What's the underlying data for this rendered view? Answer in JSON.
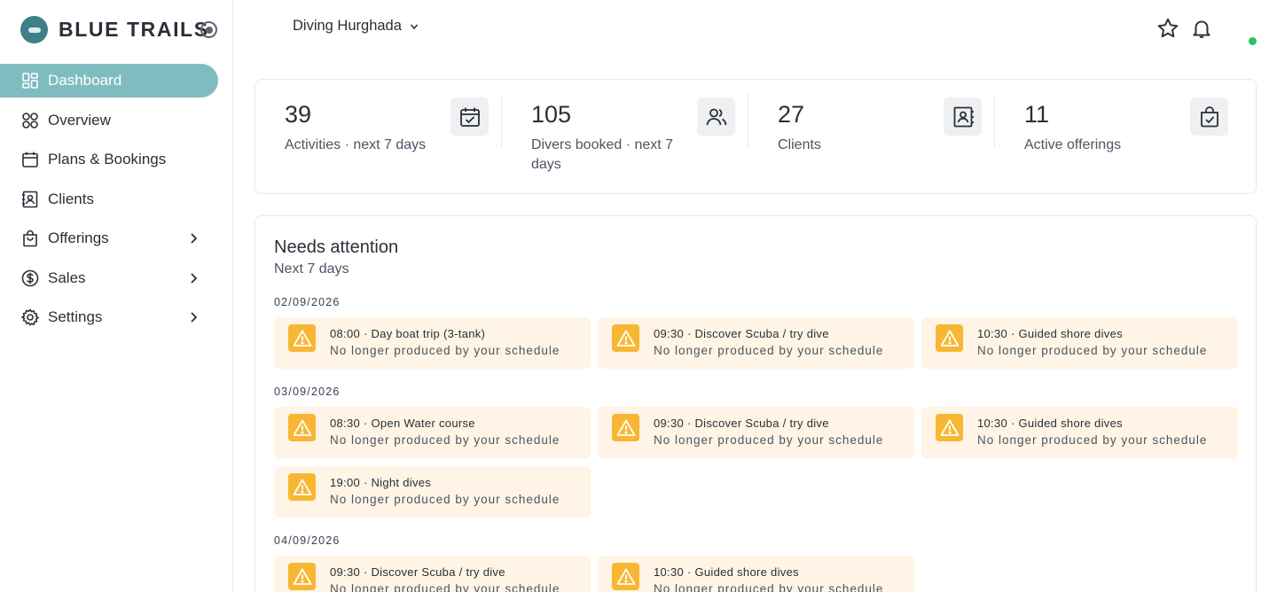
{
  "brand": {
    "name": "BLUE TRAILS"
  },
  "sidebar": {
    "items": [
      {
        "label": "Dashboard",
        "icon": "dashboard-icon",
        "active": true
      },
      {
        "label": "Overview",
        "icon": "overview-icon"
      },
      {
        "label": "Plans & Bookings",
        "icon": "calendar-icon"
      },
      {
        "label": "Clients",
        "icon": "contacts-icon"
      },
      {
        "label": "Offerings",
        "icon": "bag-icon",
        "expandable": true
      },
      {
        "label": "Sales",
        "icon": "dollar-icon",
        "expandable": true
      },
      {
        "label": "Settings",
        "icon": "gear-icon",
        "expandable": true
      }
    ]
  },
  "header": {
    "location": "Diving Hurghada",
    "icons": [
      "star-icon",
      "bell-icon"
    ],
    "status_color": "#22c55e"
  },
  "stats": [
    {
      "value": "39",
      "label": "Activities · next 7 days",
      "icon": "calendar-check-icon"
    },
    {
      "value": "105",
      "label": "Divers booked · next 7 days",
      "icon": "users-icon"
    },
    {
      "value": "27",
      "label": "Clients",
      "icon": "contacts-icon"
    },
    {
      "value": "11",
      "label": "Active offerings",
      "icon": "bag-check-icon"
    }
  ],
  "attention": {
    "title": "Needs attention",
    "subtitle": "Next 7 days",
    "days": [
      {
        "date": "02/09/2026",
        "alerts": [
          {
            "title": "08:00 · Day boat trip (3-tank)",
            "desc": "No longer produced by your schedule"
          },
          {
            "title": "09:30 · Discover Scuba / try dive",
            "desc": "No longer produced by your schedule"
          },
          {
            "title": "10:30 · Guided shore dives",
            "desc": "No longer produced by your schedule"
          }
        ]
      },
      {
        "date": "03/09/2026",
        "alerts": [
          {
            "title": "08:30 · Open Water course",
            "desc": "No longer produced by your schedule"
          },
          {
            "title": "09:30 · Discover Scuba / try dive",
            "desc": "No longer produced by your schedule"
          },
          {
            "title": "10:30 · Guided shore dives",
            "desc": "No longer produced by your schedule"
          },
          {
            "title": "19:00 · Night dives",
            "desc": "No longer produced by your schedule"
          }
        ]
      },
      {
        "date": "04/09/2026",
        "alerts": [
          {
            "title": "09:30 · Discover Scuba / try dive",
            "desc": "No longer produced by your schedule"
          },
          {
            "title": "10:30 · Guided shore dives",
            "desc": "No longer produced by your schedule"
          }
        ]
      }
    ]
  },
  "colors": {
    "accent": "#7fbcc0",
    "brand": "#3f7f87",
    "warning": "#f7b733",
    "warning_bg": "#fff4e5"
  }
}
